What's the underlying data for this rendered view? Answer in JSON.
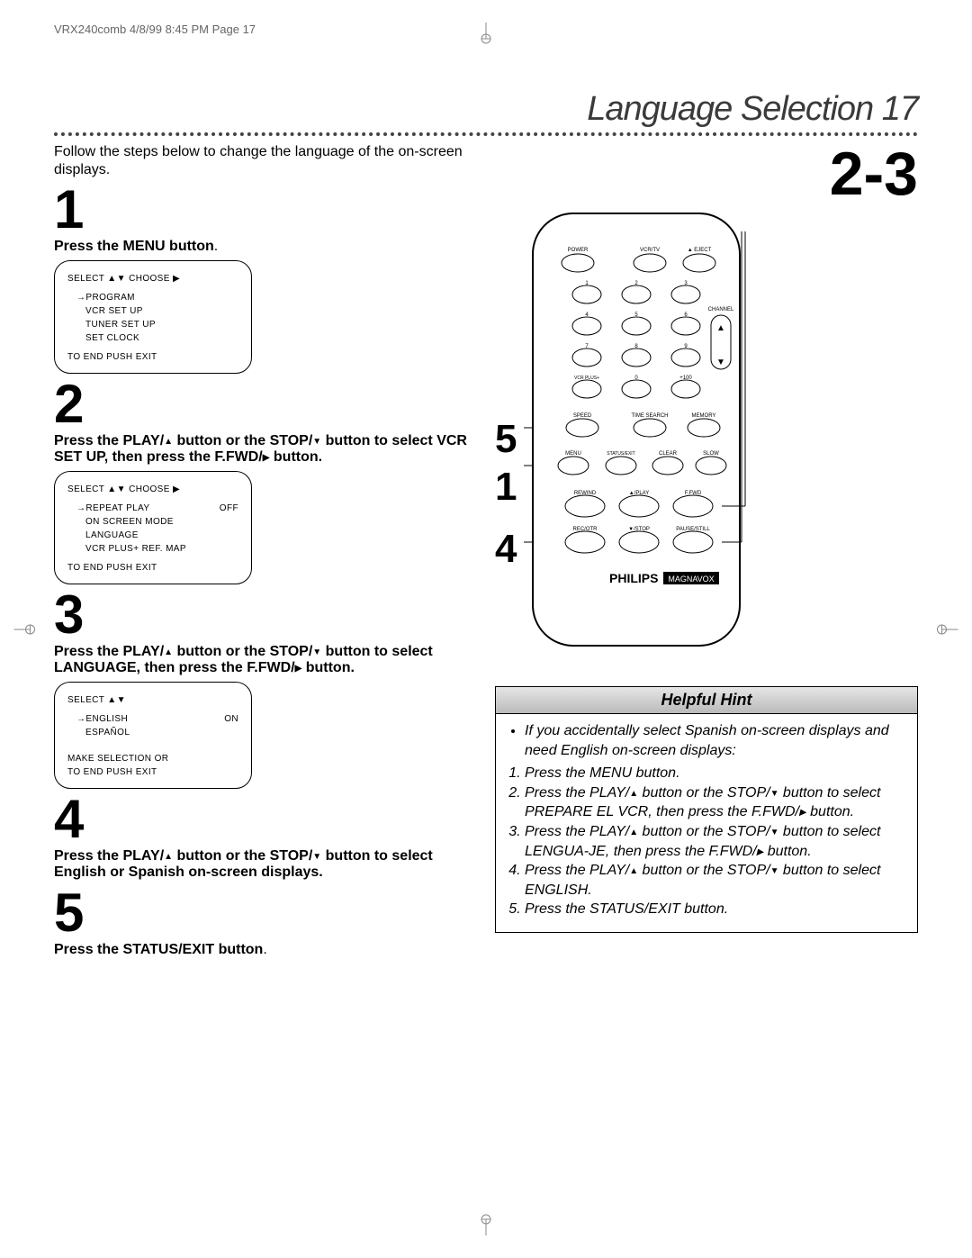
{
  "meta": {
    "header": "VRX240comb  4/8/99 8:45 PM  Page 17"
  },
  "title": "Language Selection 17",
  "intro": "Follow the steps below to change the language of the on-screen displays.",
  "right_big_num": "2-3",
  "steps": {
    "s1": {
      "num": "1",
      "text": "Press the MENU button",
      "period": "."
    },
    "s2": {
      "num": "2",
      "a": "Press the PLAY/",
      "b": " button or the STOP/",
      "c": " button to select VCR SET UP, then press the F.FWD/",
      "d": " button."
    },
    "s3": {
      "num": "3",
      "a": "Press the PLAY/",
      "b": " button or the STOP/",
      "c": " button to select LANGUAGE, then press the F.FWD/",
      "d": " button."
    },
    "s4": {
      "num": "4",
      "a": "Press the PLAY/",
      "b": " button or the STOP/",
      "c": " button to select English or Spanish on-screen displays."
    },
    "s5": {
      "num": "5",
      "text": "Press the STATUS/EXIT button",
      "period": "."
    }
  },
  "screen1": {
    "head": "SELECT ▲▼ CHOOSE ▶",
    "l1": "→PROGRAM",
    "l2": "VCR SET UP",
    "l3": "TUNER SET UP",
    "l4": "SET CLOCK",
    "foot": "TO END PUSH EXIT"
  },
  "screen2": {
    "head": "SELECT ▲▼ CHOOSE ▶",
    "l1a": "→REPEAT PLAY",
    "l1b": "OFF",
    "l2": "ON SCREEN MODE",
    "l3": "LANGUAGE",
    "l4": "VCR PLUS+ REF. MAP",
    "foot": "TO END PUSH EXIT"
  },
  "screen3": {
    "head": "SELECT ▲▼",
    "l1a": "→ENGLISH",
    "l1b": "ON",
    "l2": "ESPAÑOL",
    "foot1": "MAKE SELECTION OR",
    "foot2": "TO END PUSH EXIT"
  },
  "refnums": {
    "a": "5",
    "b": "1",
    "c": "4"
  },
  "remote": {
    "labels": {
      "power": "POWER",
      "vcrtv": "VCR/TV",
      "eject": "▲ EJECT",
      "n1": "1",
      "n2": "2",
      "n3": "3",
      "n4": "4",
      "n5": "5",
      "n6": "6",
      "n7": "7",
      "n8": "8",
      "n9": "9",
      "n0": "0",
      "vcrplus": "VCR PLUS+",
      "plus100": "+100",
      "channel": "CHANNEL",
      "speed": "SPEED",
      "timesearch": "TIME SEARCH",
      "memory": "MEMORY",
      "menu": "MENU",
      "status": "STATUS/EXIT",
      "clear": "CLEAR",
      "slow": "SLOW",
      "rewind": "REWIND",
      "play": "▲/PLAY",
      "ffwd": "F.FWD",
      "rec": "REC/OTR",
      "stop": "▼/STOP",
      "pause": "PAUSE/STILL",
      "brand1": "PHILIPS",
      "brand2": "MAGNAVOX"
    }
  },
  "hint": {
    "title": "Helpful Hint",
    "bullet": "If you accidentally select Spanish on-screen displays and need English on-screen displays:",
    "i1": "Press the MENU button.",
    "i2a": "Press the PLAY/",
    "i2b": " button or the STOP/",
    "i2c": " button to select PREPARE EL VCR, then press the F.FWD/",
    "i2d": " button.",
    "i3a": "Press the PLAY/",
    "i3b": " button or the STOP/",
    "i3c": " button to select LENGUA-JE, then press the F.FWD/",
    "i3d": " button.",
    "i4a": "Press the PLAY/",
    "i4b": " button or the STOP/",
    "i4c": " button to select ENGLISH.",
    "i5": "Press the STATUS/EXIT button."
  }
}
